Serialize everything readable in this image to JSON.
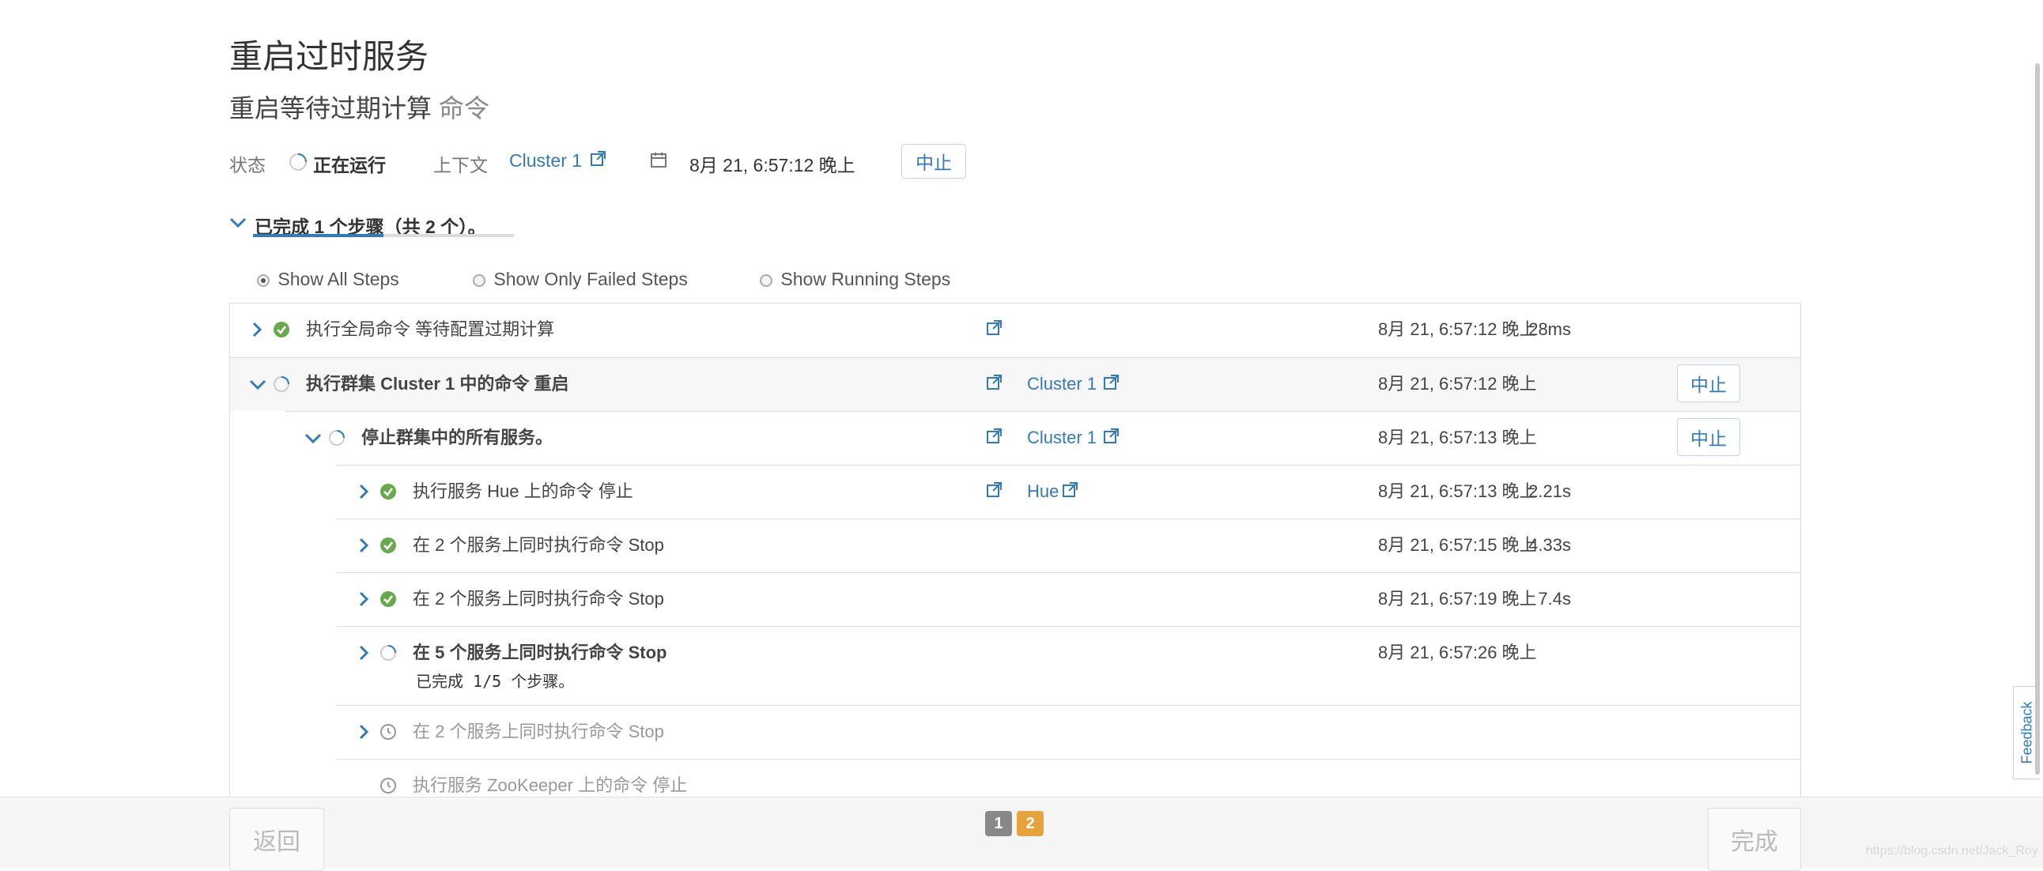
{
  "page": {
    "title": "重启过时服务",
    "subtitle": "重启等待过期计算",
    "subtitle_suffix": "命令"
  },
  "status_bar": {
    "status_label": "状态",
    "status_value": "正在运行",
    "context_label": "上下文",
    "context_link": "Cluster 1",
    "timestamp": "8月 21, 6:57:12 晚上",
    "abort_label": "中止"
  },
  "progress_summary": "已完成 1 个步骤（共 2 个）。",
  "filters": [
    {
      "label": "Show All Steps",
      "selected": true
    },
    {
      "label": "Show Only Failed Steps",
      "selected": false
    },
    {
      "label": "Show Running Steps",
      "selected": false
    }
  ],
  "steps": [
    {
      "indent": 0,
      "icon": "check-circle-icon",
      "expand": "chevron-right-icon",
      "text": "执行全局命令 等待配置过期计算",
      "bold": false,
      "muted": false,
      "link": "",
      "time": "8月 21, 6:57:12 晚上",
      "duration": "28ms",
      "action": "",
      "sub": ""
    },
    {
      "indent": 0,
      "icon": "spinner-icon",
      "expand": "chevron-down-icon",
      "text": "执行群集 Cluster 1 中的命令 重启",
      "bold": true,
      "muted": false,
      "link": "Cluster 1",
      "time": "8月 21, 6:57:12 晚上",
      "duration": "",
      "action": "中止",
      "sub": ""
    },
    {
      "indent": 1,
      "icon": "spinner-icon",
      "expand": "chevron-down-icon",
      "text": "停止群集中的所有服务。",
      "bold": true,
      "muted": false,
      "link": "Cluster 1",
      "time": "8月 21, 6:57:13 晚上",
      "duration": "",
      "action": "中止",
      "sub": ""
    },
    {
      "indent": 2,
      "icon": "check-circle-icon",
      "expand": "chevron-right-icon",
      "text": "执行服务 Hue 上的命令 停止",
      "bold": false,
      "muted": false,
      "link": "Hue",
      "time": "8月 21, 6:57:13 晚上",
      "duration": "2.21s",
      "action": "",
      "sub": ""
    },
    {
      "indent": 2,
      "icon": "check-circle-icon",
      "expand": "chevron-right-icon",
      "text": "在 2 个服务上同时执行命令 Stop",
      "bold": false,
      "muted": false,
      "link": "",
      "time": "8月 21, 6:57:15 晚上",
      "duration": "4.33s",
      "action": "",
      "sub": ""
    },
    {
      "indent": 2,
      "icon": "check-circle-icon",
      "expand": "chevron-right-icon",
      "text": "在 2 个服务上同时执行命令 Stop",
      "bold": false,
      "muted": false,
      "link": "",
      "time": "8月 21, 6:57:19 晚上",
      "duration": "7.4s",
      "action": "",
      "sub": ""
    },
    {
      "indent": 2,
      "icon": "spinner-icon",
      "expand": "chevron-right-icon",
      "text": "在 5 个服务上同时执行命令 Stop",
      "bold": true,
      "muted": false,
      "link": "",
      "time": "8月 21, 6:57:26 晚上",
      "duration": "",
      "action": "",
      "sub": "已完成 1/5 个步骤。"
    },
    {
      "indent": 2,
      "icon": "clock-icon",
      "expand": "chevron-right-icon",
      "text": "在 2 个服务上同时执行命令 Stop",
      "bold": false,
      "muted": true,
      "link": "",
      "time": "",
      "duration": "",
      "action": "",
      "sub": ""
    },
    {
      "indent": 2,
      "icon": "clock-icon",
      "expand": "",
      "text": "执行服务 ZooKeeper 上的命令 停止",
      "bold": false,
      "muted": true,
      "link": "",
      "time": "",
      "duration": "",
      "action": "",
      "sub": ""
    }
  ],
  "footer": {
    "back_label": "返回",
    "finish_label": "完成",
    "pages": [
      "1",
      "2"
    ],
    "active_page": "2",
    "watermark": "https://blog.csdn.net/Jack_Roy"
  },
  "feedback_label": "Feedback",
  "colors": {
    "link": "#337ab7",
    "success": "#6aa84f",
    "active_page": "#e6a23c",
    "inactive_page": "#888888"
  }
}
